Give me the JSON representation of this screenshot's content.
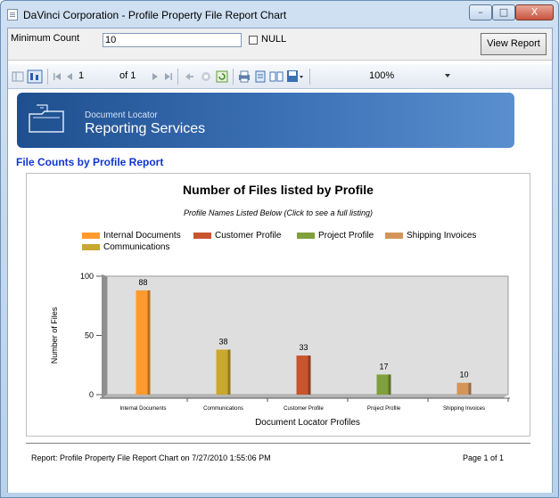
{
  "window": {
    "title": "DaVinci Corporation - Profile Property File Report Chart",
    "buttons": {
      "minimize": "–",
      "maximize": "□",
      "close": "X"
    }
  },
  "params": {
    "min_count_label": "Minimum Count",
    "min_count_value": "10",
    "null_label": "NULL",
    "view_report_label": "View Report"
  },
  "toolbar": {
    "page_current": "1",
    "page_of": "of 1",
    "zoom": "100%",
    "icons": [
      "document-map-icon",
      "parameters-icon",
      "first-page-icon",
      "previous-page-icon",
      "next-page-icon",
      "last-page-icon",
      "back-icon",
      "stop-icon",
      "refresh-icon",
      "print-icon",
      "print-layout-icon",
      "page-setup-icon",
      "export-icon"
    ]
  },
  "banner": {
    "brand_small": "Document Locator",
    "brand_big": "Reporting Services"
  },
  "report": {
    "link_title": "File Counts by Profile Report"
  },
  "chart_data": {
    "type": "bar",
    "title": "Number of Files listed by Profile",
    "subtitle": "Profile Names Listed Below (Click to see a full listing)",
    "xlabel": "Document Locator Profiles",
    "ylabel": "Number of Files",
    "ylim": [
      0,
      100
    ],
    "yticks": [
      0,
      50,
      100
    ],
    "grid": false,
    "legend_position": "top",
    "categories": [
      "Internal Documents",
      "Communications",
      "Customer Profile",
      "Project Profile",
      "Shipping Invoices"
    ],
    "values": [
      88,
      38,
      33,
      17,
      10
    ],
    "colors": [
      "#ff9a2e",
      "#c8a82e",
      "#c8552e",
      "#7fa03a",
      "#d4955a"
    ],
    "legend": [
      {
        "name": "Internal Documents",
        "color": "#ff9a2e"
      },
      {
        "name": "Customer Profile",
        "color": "#c8552e"
      },
      {
        "name": "Project Profile",
        "color": "#7fa03a"
      },
      {
        "name": "Shipping Invoices",
        "color": "#d4955a"
      },
      {
        "name": "Communications",
        "color": "#c8a82e"
      }
    ]
  },
  "footer": {
    "left": "Report: Profile Property File Report Chart on 7/27/2010 1:55:06 PM",
    "right": "Page 1 of 1"
  }
}
